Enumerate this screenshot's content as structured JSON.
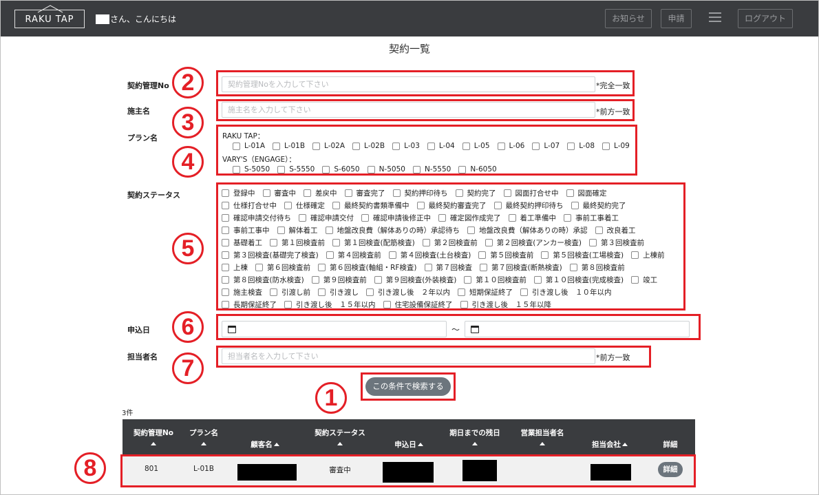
{
  "header": {
    "logo_text": "RAKU TAP",
    "greeting": "さん、こんにちは",
    "buttons": {
      "news": "お知らせ",
      "apply": "申請",
      "logout": "ログアウト"
    }
  },
  "page_title": "契約一覧",
  "form": {
    "contract_no": {
      "label": "契約管理No",
      "placeholder": "契約管理Noを入力して下さい",
      "note": "*完全一致"
    },
    "owner_name": {
      "label": "施主名",
      "placeholder": "施主名を入力して下さい",
      "note": "*前方一致"
    },
    "plan": {
      "label": "プラン名",
      "groups": [
        {
          "title": "RAKU TAP：",
          "options": [
            "L-01A",
            "L-01B",
            "L-02A",
            "L-02B",
            "L-03",
            "L-04",
            "L-05",
            "L-06",
            "L-07",
            "L-08",
            "L-09"
          ]
        },
        {
          "title": "VARY'S（ENGAGE）：",
          "options": [
            "S-5050",
            "S-5550",
            "S-6050",
            "N-5050",
            "N-5550",
            "N-6050"
          ]
        }
      ]
    },
    "status": {
      "label": "契約ステータス",
      "rows": [
        [
          "登録中",
          "審査中",
          "差戻中",
          "審査完了",
          "契約押印待ち",
          "契約完了",
          "図面打合せ中",
          "図面確定"
        ],
        [
          "仕様打合せ中",
          "仕様確定",
          "最終契約書類準備中",
          "最終契約審査完了",
          "最終契約押印待ち",
          "最終契約完了"
        ],
        [
          "確認申請交付待ち",
          "確認申請交付",
          "確認申請後修正中",
          "確定図作成完了",
          "着工準備中",
          "事前工事着工"
        ],
        [
          "事前工事中",
          "解体着工",
          "地盤改良費（解体ありの時）承認待ち",
          "地盤改良費（解体ありの時）承認",
          "改良着工"
        ],
        [
          "基礎着工",
          "第１回検査前",
          "第１回検査(配筋検査)",
          "第２回検査前",
          "第２回検査(アンカー検査)",
          "第３回検査前"
        ],
        [
          "第３回検査(基礎完了検査)",
          "第４回検査前",
          "第４回検査(土台検査)",
          "第５回検査前",
          "第５回検査(工場検査)",
          "上棟前"
        ],
        [
          "上棟",
          "第６回検査前",
          "第６回検査(軸組・RF検査)",
          "第７回検査",
          "第７回検査(断熱検査)",
          "第８回検査前"
        ],
        [
          "第８回検査(防水検査)",
          "第９回検査前",
          "第９回検査(外装検査)",
          "第１０回検査前",
          "第１０回検査(完成検査)",
          "竣工"
        ],
        [
          "施主検査",
          "引渡し前",
          "引き渡し",
          "引き渡し後　２年以内",
          "短期保証終了",
          "引き渡し後　１０年以内"
        ],
        [
          "長期保証終了",
          "引き渡し後　１５年以内",
          "住宅設備保証終了",
          "引き渡し後　１５年以降"
        ]
      ]
    },
    "apply_date": {
      "label": "申込日",
      "separator": "～"
    },
    "staff_name": {
      "label": "担当者名",
      "placeholder": "担当者名を入力して下さい",
      "note": "*前方一致"
    },
    "search_button": "この条件で検索する"
  },
  "markers": [
    "1",
    "2",
    "3",
    "4",
    "5",
    "6",
    "7",
    "8"
  ],
  "results": {
    "count": "3件",
    "columns": [
      "契約管理No",
      "プラン名",
      "顧客名",
      "契約ステータス",
      "申込日",
      "期日までの残日",
      "営業担当者名",
      "担当会社",
      "詳細"
    ],
    "rows": [
      {
        "contract_no": "801",
        "plan": "L-01B",
        "status": "審査中",
        "detail": "詳細"
      }
    ]
  },
  "colors": {
    "header_bg": "#3a3c3f",
    "accent_red": "#e41f26",
    "button_gray": "#6c757d"
  }
}
